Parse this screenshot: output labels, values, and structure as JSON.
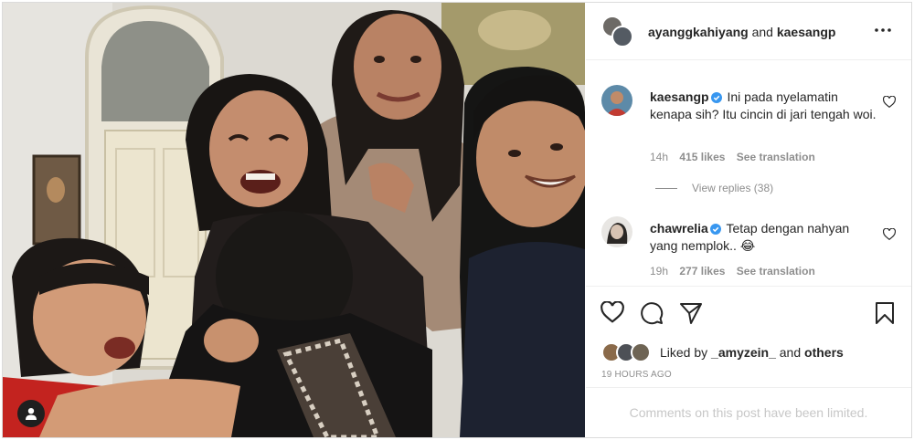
{
  "header": {
    "author_1": "ayanggkahiyang",
    "conjunction": "and",
    "author_2": "kaesangp",
    "more_icon": "more-horizontal-icon"
  },
  "comments": [
    {
      "username": "kaesangp",
      "verified": true,
      "text": "Ini pada nyelamatin kenapa sih? Itu cincin di jari tengah woi.",
      "time": "14h",
      "likes": "415 likes",
      "translate": "See translation"
    },
    {
      "username": "chawrelia",
      "verified": true,
      "text": "Tetap dengan nahyan yang nemplok.. 😂",
      "time": "19h",
      "likes": "277 likes",
      "translate": "See translation"
    }
  ],
  "view_replies": "View replies (38)",
  "actions": {
    "like_icon": "heart-icon",
    "comment_icon": "comment-icon",
    "share_icon": "send-icon",
    "save_icon": "bookmark-icon"
  },
  "liked_by": {
    "prefix": "Liked by",
    "user": "_amyzein_",
    "conj": "and",
    "others": "others"
  },
  "time_ago": "19 HOURS AGO",
  "comments_limited": "Comments on this post have been limited.",
  "colors": {
    "verified": "#3897f0",
    "muted": "#8e8e8e",
    "text": "#262626",
    "border": "#dbdbdb"
  }
}
